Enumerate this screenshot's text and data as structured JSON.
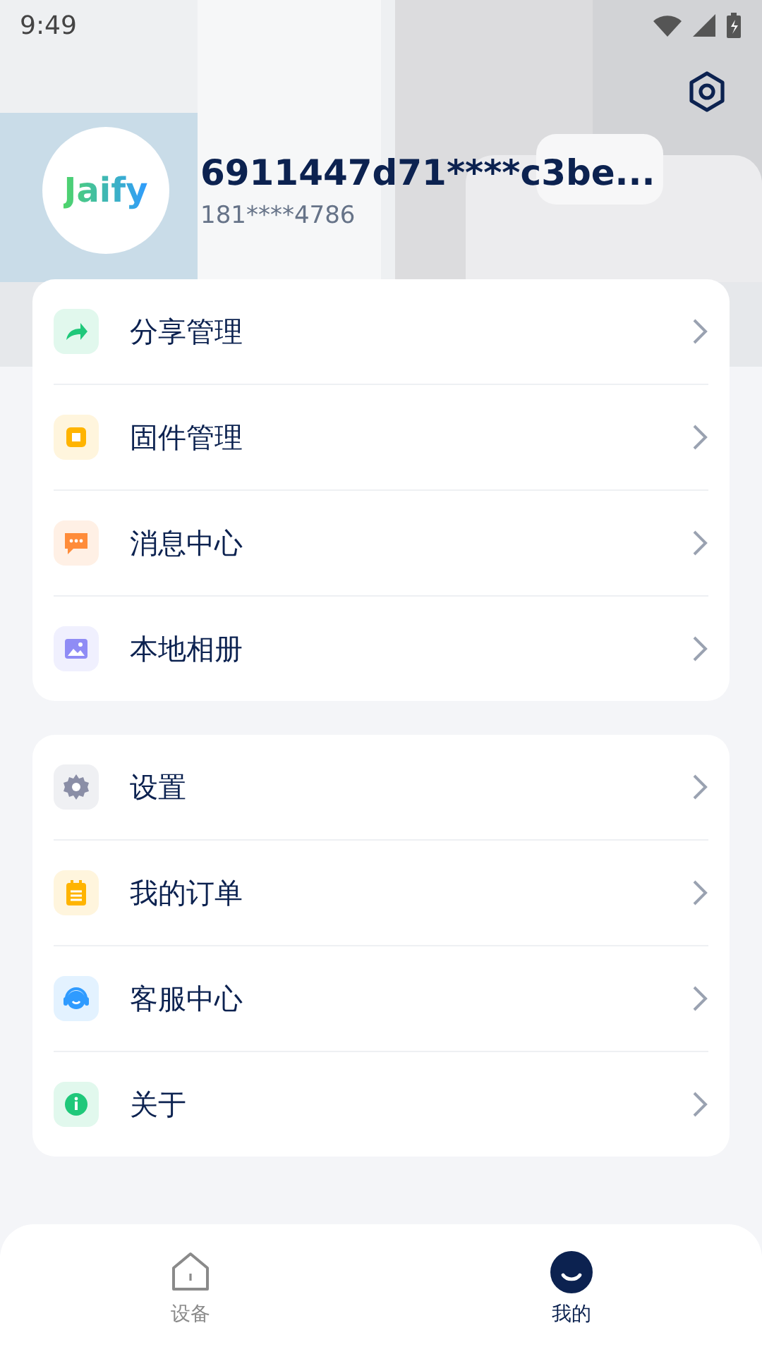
{
  "status_bar": {
    "time": "9:49"
  },
  "profile": {
    "avatar_text": "Jaify",
    "name": "6911447d71****c3be...",
    "phone": "181****4786"
  },
  "groups": [
    {
      "items": [
        {
          "label": "分享管理",
          "kind": "share",
          "color": "#1fc87a"
        },
        {
          "label": "固件管理",
          "kind": "chip",
          "color": "#ffb400"
        },
        {
          "label": "消息中心",
          "kind": "message",
          "color": "#ff8c3a"
        },
        {
          "label": "本地相册",
          "color": "#8f8cf5"
        }
      ]
    },
    {
      "items": [
        {
          "label": "设置",
          "kind": "gear",
          "color": "#8a8ea6"
        },
        {
          "label": "我的订单",
          "kind": "order",
          "color": "#ffb400"
        },
        {
          "label": "客服中心",
          "kind": "service",
          "color": "#2f9bff"
        },
        {
          "label": "关于",
          "kind": "info",
          "color": "#1fc87a"
        }
      ]
    }
  ],
  "tabs": [
    {
      "label": "设备",
      "kind": "home",
      "selected": false
    },
    {
      "label": "我的",
      "kind": "me",
      "selected": true
    }
  ]
}
